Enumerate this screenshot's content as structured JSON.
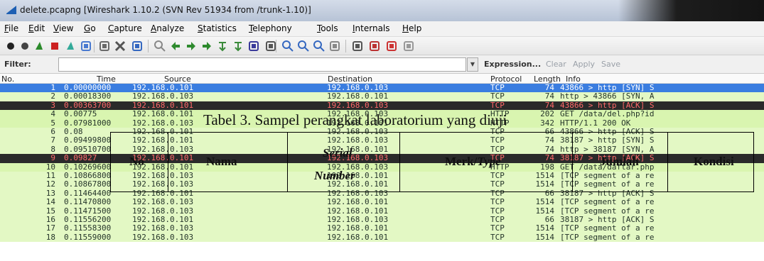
{
  "window": {
    "title": "delete.pcapng   [Wireshark 1.10.2  (SVN Rev 51934 from /trunk-1.10)]"
  },
  "menu": [
    "File",
    "Edit",
    "View",
    "Go",
    "Capture",
    "Analyze",
    "Statistics",
    "Telephony",
    "Tools",
    "Internals",
    "Help"
  ],
  "toolbar_icons": [
    "interface-list-icon",
    "capture-options-icon",
    "start-capture-icon",
    "stop-capture-icon",
    "restart-capture-icon",
    "open-file-icon",
    "save-file-icon",
    "close-file-icon",
    "reload-icon",
    "find-packet-icon",
    "go-back-icon",
    "go-forward-icon",
    "go-to-packet-icon",
    "go-first-icon",
    "go-last-icon",
    "colorize-icon",
    "auto-scroll-icon",
    "zoom-in-icon",
    "zoom-out-icon",
    "normal-size-icon",
    "resize-columns-icon",
    "capture-filters-icon",
    "display-filters-icon",
    "coloring-rules-icon",
    "preferences-icon"
  ],
  "filter": {
    "label": "Filter:",
    "value": "",
    "expression": "Expression...",
    "clear": "Clear",
    "apply": "Apply",
    "save": "Save"
  },
  "columns": [
    "No.",
    "Time",
    "Source",
    "Destination",
    "Protocol",
    "Length",
    "Info"
  ],
  "packets": [
    {
      "no": "1",
      "time": "0.00000000",
      "src": "192.168.0.101",
      "dst": "192.168.0.103",
      "proto": "TCP",
      "len": "74",
      "info": "43866 > http [SYN] S"
    },
    {
      "no": "2",
      "time": "0.00018300",
      "src": "192.168.0.103",
      "dst": "192.168.0.101",
      "proto": "TCP",
      "len": "74",
      "info": "http > 43866 [SYN, A"
    },
    {
      "no": "3",
      "time": "0.00363700",
      "src": "192.168.0.101",
      "dst": "192.168.0.103",
      "proto": "TCP",
      "len": "74",
      "info": "43866 > http [ACK] S"
    },
    {
      "no": "4",
      "time": "0.00775",
      "src": "192.168.0.101",
      "dst": "192.168.0.103",
      "proto": "HTTP",
      "len": "202",
      "info": "GET /data/del.php?id"
    },
    {
      "no": "5",
      "time": "0.07981000",
      "src": "192.168.0.103",
      "dst": "192.168.0.101",
      "proto": "HTTP",
      "len": "342",
      "info": "HTTP/1.1 200 OK"
    },
    {
      "no": "6",
      "time": "0.08",
      "src": "192.168.0.101",
      "dst": "192.168.0.103",
      "proto": "TCP",
      "len": "66",
      "info": "43866 > http [ACK] S"
    },
    {
      "no": "7",
      "time": "0.09499800",
      "src": "192.168.0.101",
      "dst": "192.168.0.103",
      "proto": "TCP",
      "len": "74",
      "info": "38187 > http [SYN] S"
    },
    {
      "no": "8",
      "time": "0.09510700",
      "src": "192.168.0.103",
      "dst": "192.168.0.101",
      "proto": "TCP",
      "len": "74",
      "info": "http > 38187 [SYN, A"
    },
    {
      "no": "9",
      "time": "0.09827",
      "src": "192.168.0.101",
      "dst": "192.168.0.103",
      "proto": "TCP",
      "len": "74",
      "info": "38187 > http [ACK] S"
    },
    {
      "no": "10",
      "time": "0.10269600",
      "src": "192.168.0.101",
      "dst": "192.168.0.103",
      "proto": "HTTP",
      "len": "198",
      "info": "GET /data/daftar.php"
    },
    {
      "no": "11",
      "time": "0.10866800",
      "src": "192.168.0.103",
      "dst": "192.168.0.101",
      "proto": "TCP",
      "len": "1514",
      "info": "[TCP segment of a re"
    },
    {
      "no": "12",
      "time": "0.10867800",
      "src": "192.168.0.103",
      "dst": "192.168.0.101",
      "proto": "TCP",
      "len": "1514",
      "info": "[TCP segment of a re"
    },
    {
      "no": "13",
      "time": "0.11464400",
      "src": "192.168.0.101",
      "dst": "192.168.0.103",
      "proto": "TCP",
      "len": "66",
      "info": "38187 > http [ACK] S"
    },
    {
      "no": "14",
      "time": "0.11470800",
      "src": "192.168.0.103",
      "dst": "192.168.0.101",
      "proto": "TCP",
      "len": "1514",
      "info": "[TCP segment of a re"
    },
    {
      "no": "15",
      "time": "0.11471500",
      "src": "192.168.0.103",
      "dst": "192.168.0.101",
      "proto": "TCP",
      "len": "1514",
      "info": "[TCP segment of a re"
    },
    {
      "no": "16",
      "time": "0.11556200",
      "src": "192.168.0.101",
      "dst": "192.168.0.103",
      "proto": "TCP",
      "len": "66",
      "info": "38187 > http [ACK] S"
    },
    {
      "no": "17",
      "time": "0.11558300",
      "src": "192.168.0.103",
      "dst": "192.168.0.101",
      "proto": "TCP",
      "len": "1514",
      "info": "[TCP segment of a re"
    },
    {
      "no": "18",
      "time": "0.11559000",
      "src": "192.168.0.103",
      "dst": "192.168.0.101",
      "proto": "TCP",
      "len": "1514",
      "info": "[TCP segment of a re"
    }
  ],
  "overlay": {
    "caption": "Tabel 3. Sampel perangkat laboratorium yang diuji",
    "headers": [
      "No",
      "Nama",
      "Serial Number",
      "Merk/Type",
      "Jumlah",
      "Kondisi"
    ],
    "serial_line1": "Serial",
    "serial_line2": "Number",
    "merk": "Merk/",
    "type": "Type"
  },
  "colors": {
    "selected": "#3a7de0",
    "tcp_row": "#e3f8c4",
    "dark_row": "#2a2a2a",
    "dark_row_text": "#ff6a6a"
  }
}
